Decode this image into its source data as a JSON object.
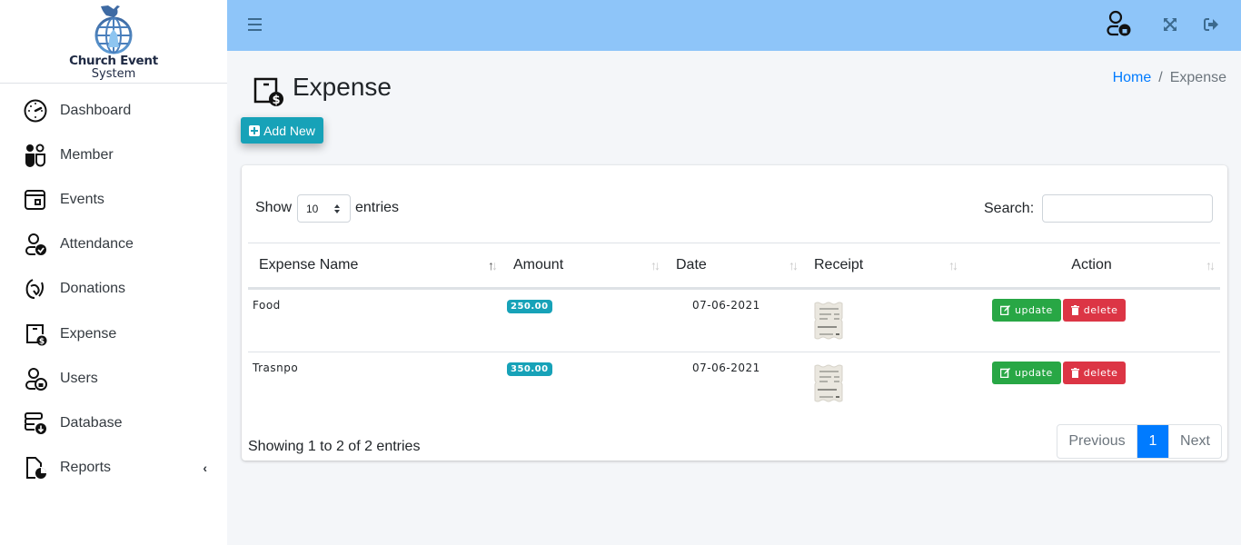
{
  "brand": {
    "title": "Church Event",
    "subtitle": "System"
  },
  "sidebar": {
    "items": [
      {
        "label": "Dashboard",
        "icon": "speedometer-icon"
      },
      {
        "label": "Member",
        "icon": "people-icon"
      },
      {
        "label": "Events",
        "icon": "calendar-icon"
      },
      {
        "label": "Attendance",
        "icon": "person-check-icon"
      },
      {
        "label": "Donations",
        "icon": "hand-donation-icon"
      },
      {
        "label": "Expense",
        "icon": "expense-icon"
      },
      {
        "label": "Users",
        "icon": "person-lock-icon"
      },
      {
        "label": "Database",
        "icon": "database-download-icon"
      },
      {
        "label": "Reports",
        "icon": "report-icon",
        "chevron": "‹"
      }
    ]
  },
  "topbar": {
    "menu_icon": "hamburger-icon",
    "user_icon": "person-lock-icon",
    "expand_icon": "expand-icon",
    "logout_icon": "logout-icon",
    "color": "#8ec5f9"
  },
  "page": {
    "title": "Expense",
    "breadcrumb": {
      "home": "Home",
      "separator": "/",
      "current": "Expense"
    },
    "add_button": "Add New"
  },
  "table_controls": {
    "show_label": "Show",
    "entries_label": "entries",
    "page_length": "10",
    "search_label": "Search:",
    "search_value": ""
  },
  "table": {
    "columns": [
      "Expense Name",
      "Amount",
      "Date",
      "Receipt",
      "Action"
    ],
    "rows": [
      {
        "name": "Food",
        "amount": "250.00",
        "date": "07-06-2021",
        "receipt": "receipt-image",
        "update": "update",
        "delete": "delete"
      },
      {
        "name": "Trasnpo",
        "amount": "350.00",
        "date": "07-06-2021",
        "receipt": "receipt-image",
        "update": "update",
        "delete": "delete"
      }
    ]
  },
  "footer": {
    "info": "Showing 1 to 2 of 2 entries",
    "previous": "Previous",
    "current_page": "1",
    "next": "Next"
  },
  "colors": {
    "accent": "#17a2b8",
    "primary": "#007bff",
    "success": "#28a745",
    "danger": "#dc3545"
  }
}
